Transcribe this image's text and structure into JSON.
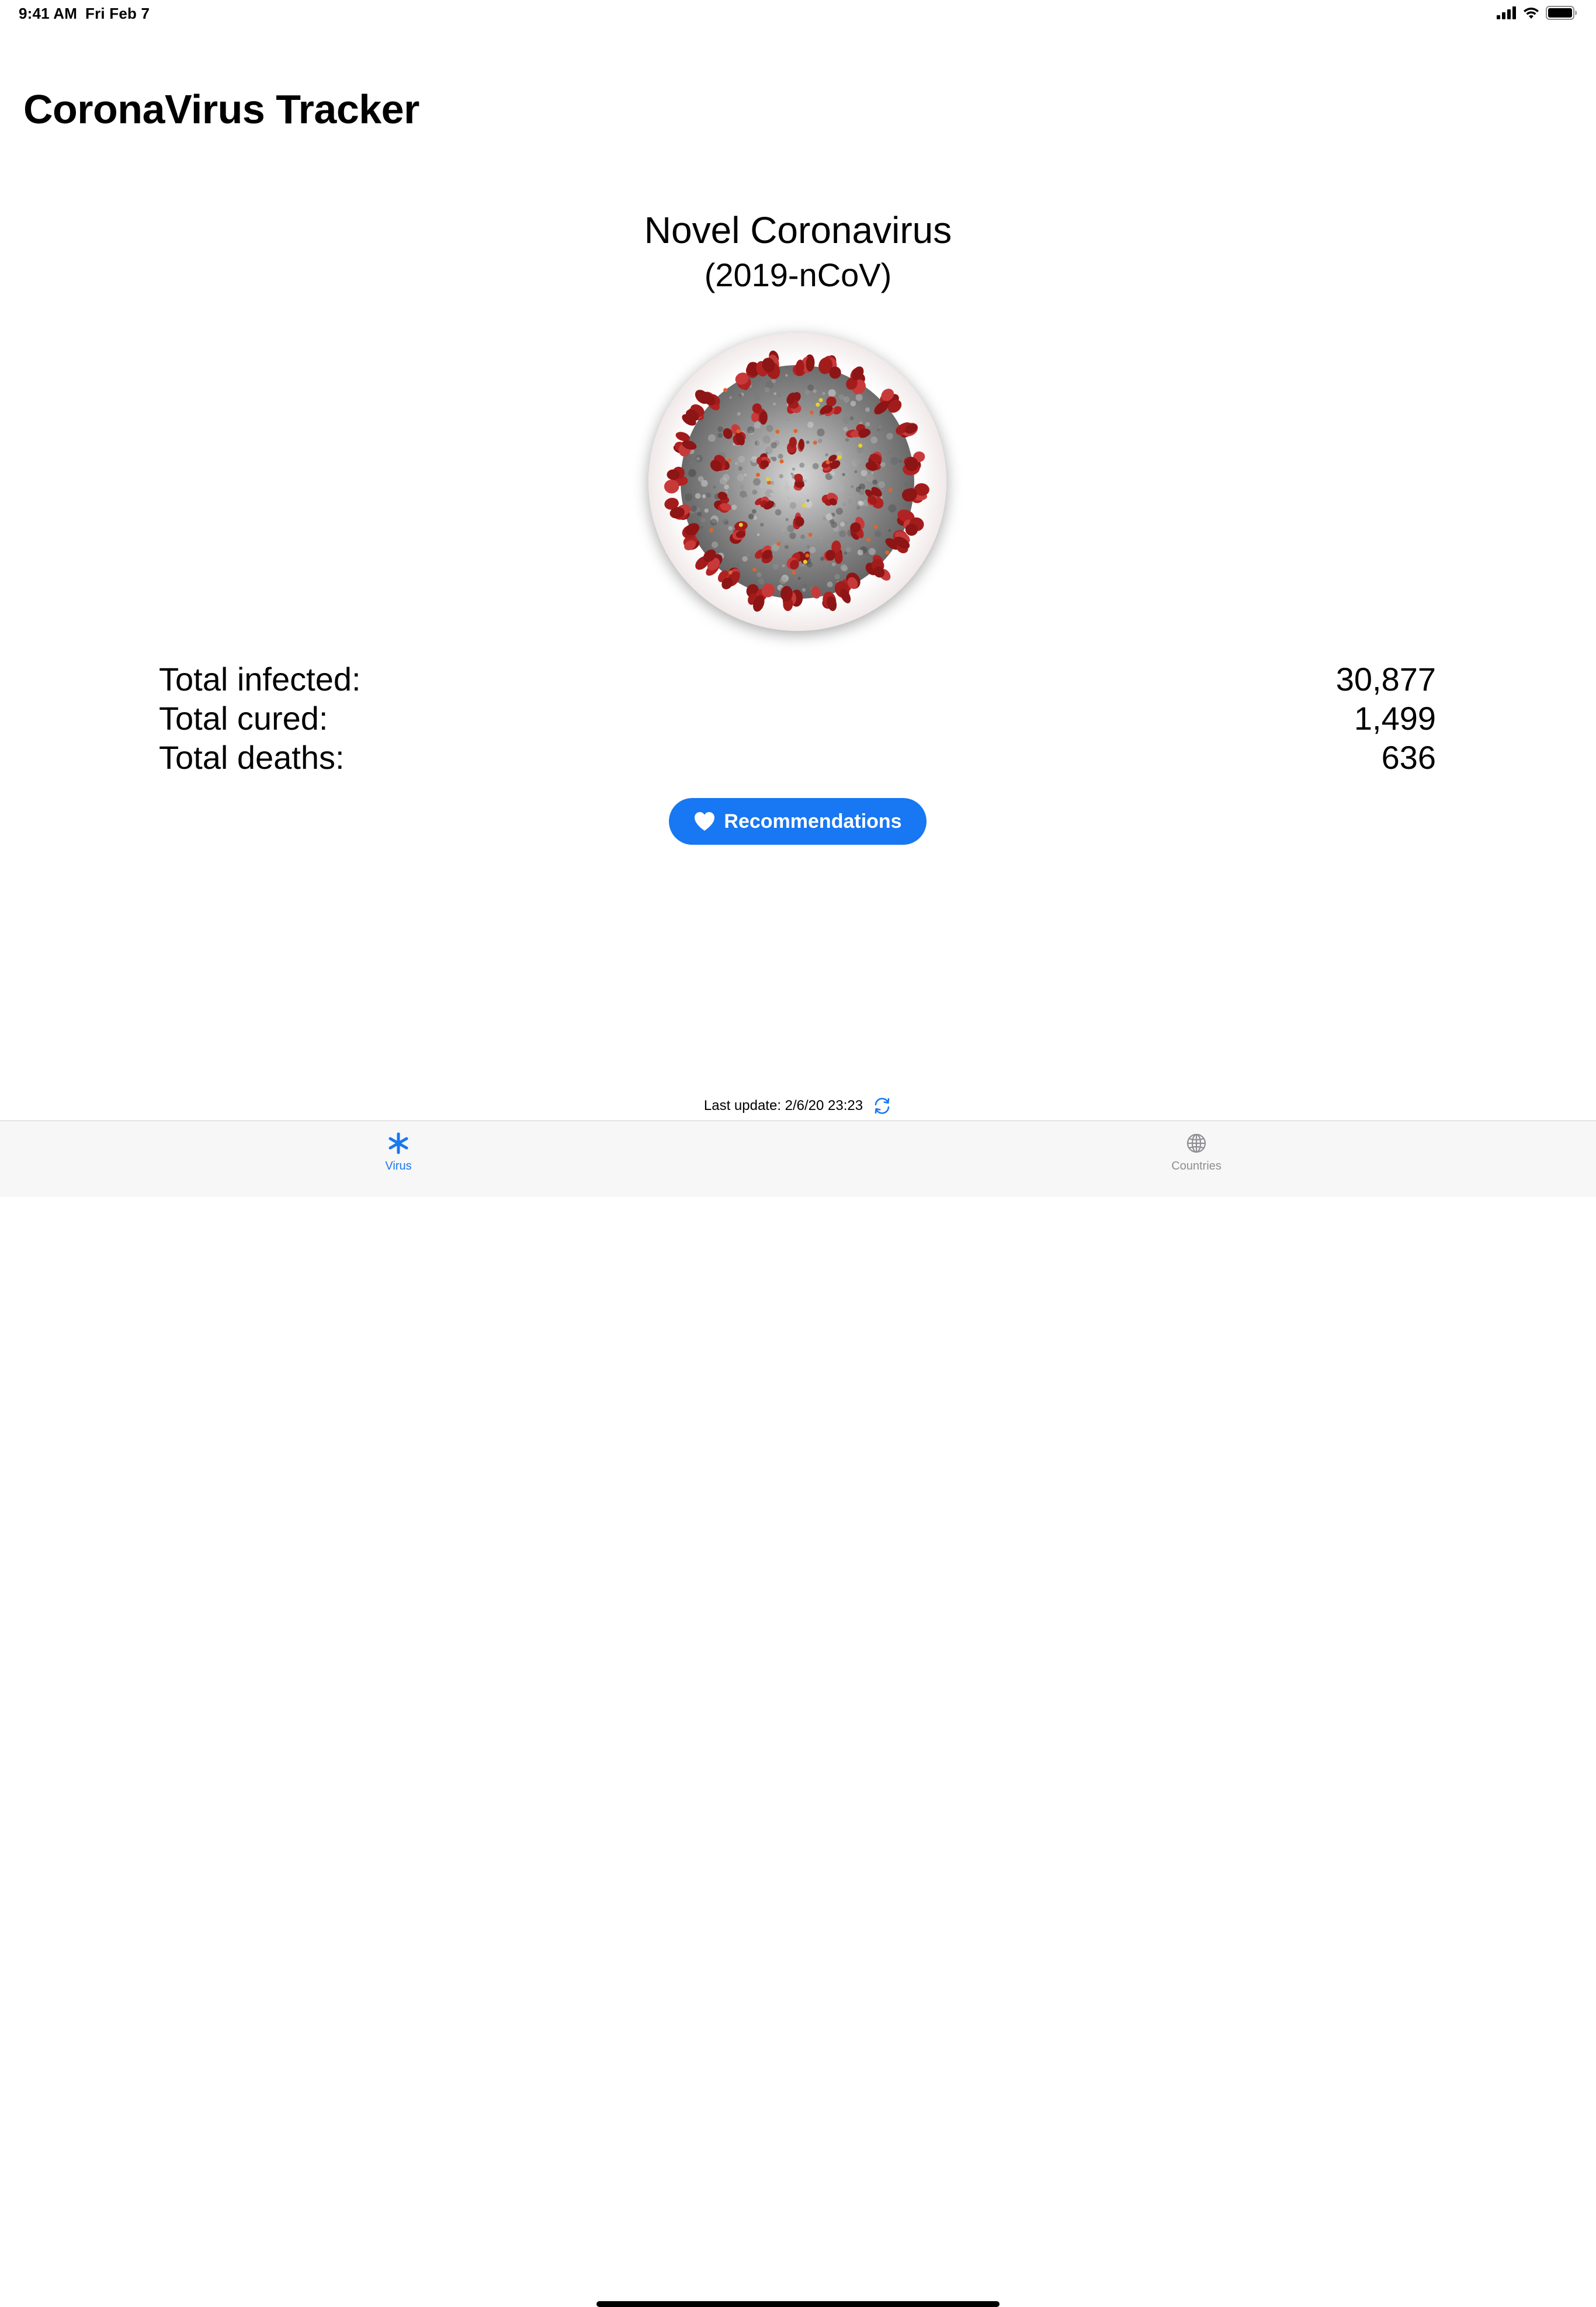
{
  "status_bar": {
    "time": "9:41 AM",
    "date": "Fri Feb 7"
  },
  "app": {
    "title": "CoronaVirus Tracker"
  },
  "virus": {
    "name": "Novel Coronavirus",
    "code": "(2019-nCoV)"
  },
  "stats": [
    {
      "label": "Total infected:",
      "value": "30,877"
    },
    {
      "label": "Total cured:",
      "value": "1,499"
    },
    {
      "label": "Total deaths:",
      "value": "636"
    }
  ],
  "recommendations_button": {
    "label": "Recommendations",
    "icon": "heart-icon"
  },
  "last_update": {
    "text": "Last update: 2/6/20 23:23",
    "icon": "refresh-icon"
  },
  "tabs": [
    {
      "label": "Virus",
      "icon": "asterisk-icon",
      "selected": true
    },
    {
      "label": "Countries",
      "icon": "globe-icon",
      "selected": false
    }
  ],
  "colors": {
    "accent": "#1877f2",
    "inactive_tab": "#8e8e93",
    "tab_bar_background": "#f7f7f7",
    "virus_spike": "#b22222",
    "virus_body": "#8a8a8a"
  }
}
